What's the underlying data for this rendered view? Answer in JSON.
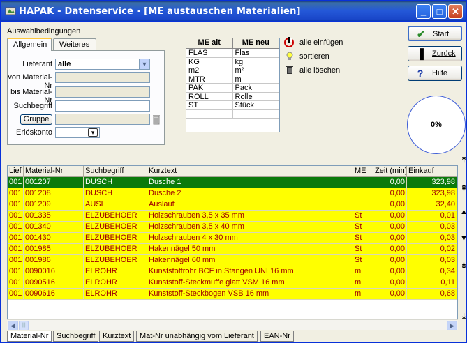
{
  "window": {
    "title": "HAPAK - Datenservice - [ME austauschen Materialien]",
    "minimize": "_",
    "maximize": "□",
    "close": "✕"
  },
  "selection": {
    "group_label": "Auswahlbedingungen",
    "tabs": [
      "Allgemein",
      "Weiteres"
    ],
    "active_tab": "Allgemein",
    "lieferant_label": "Lieferant",
    "lieferant_value": "alle",
    "von_label": "von Material-Nr",
    "bis_label": "bis Material-Nr",
    "such_label": "Suchbegriff",
    "gruppe_button": "Gruppe",
    "erloes_label": "Erlöskonto"
  },
  "me_table": {
    "headers": [
      "ME alt",
      "ME neu"
    ],
    "rows": [
      [
        "FLAS",
        "Flas"
      ],
      [
        "KG",
        "kg"
      ],
      [
        "m2",
        "m²"
      ],
      [
        "MTR",
        "m"
      ],
      [
        "PAK",
        "Pack"
      ],
      [
        "ROLL",
        "Rolle"
      ],
      [
        "ST",
        "Stück"
      ],
      [
        "",
        ""
      ]
    ]
  },
  "actions": {
    "insert_all": "alle einfügen",
    "sort": "sortieren",
    "delete_all": "alle löschen"
  },
  "buttons": {
    "start": "Start",
    "back": "Zurück",
    "help": "Hilfe"
  },
  "progress": {
    "percent": 0,
    "label": "0%"
  },
  "grid": {
    "headers": [
      "Lief",
      "Material-Nr",
      "Suchbegriff",
      "Kurztext",
      "ME",
      "Zeit (min)",
      "Einkauf"
    ],
    "rows": [
      {
        "lief": "001",
        "nr": "001207",
        "such": "DUSCH",
        "kurz": "Dusche 1",
        "me": "",
        "zeit": "0,00",
        "ek": "323,98",
        "style": "green"
      },
      {
        "lief": "001",
        "nr": "001208",
        "such": "DUSCH",
        "kurz": "Dusche 2",
        "me": "",
        "zeit": "0,00",
        "ek": "323,98",
        "style": "yellow"
      },
      {
        "lief": "001",
        "nr": "001209",
        "such": "AUSL",
        "kurz": "Auslauf",
        "me": "",
        "zeit": "0,00",
        "ek": "32,40",
        "style": "yellow"
      },
      {
        "lief": "001",
        "nr": "001335",
        "such": "ELZUBEHOER",
        "kurz": "Holzschrauben 3,5 x 35 mm",
        "me": "St",
        "zeit": "0,00",
        "ek": "0,01",
        "style": "yellow"
      },
      {
        "lief": "001",
        "nr": "001340",
        "such": "ELZUBEHOER",
        "kurz": "Holzschrauben 3,5 x 40 mm",
        "me": "St",
        "zeit": "0,00",
        "ek": "0,03",
        "style": "yellow"
      },
      {
        "lief": "001",
        "nr": "001430",
        "such": "ELZUBEHOER",
        "kurz": "Holzschrauben 4 x 30 mm",
        "me": "St",
        "zeit": "0,00",
        "ek": "0,03",
        "style": "yellow"
      },
      {
        "lief": "001",
        "nr": "001985",
        "such": "ELZUBEHOER",
        "kurz": "Hakennägel 50 mm",
        "me": "St",
        "zeit": "0,00",
        "ek": "0,02",
        "style": "yellow"
      },
      {
        "lief": "001",
        "nr": "001986",
        "such": "ELZUBEHOER",
        "kurz": "Hakennägel 60 mm",
        "me": "St",
        "zeit": "0,00",
        "ek": "0,03",
        "style": "yellow"
      },
      {
        "lief": "001",
        "nr": "0090016",
        "such": "ELROHR",
        "kurz": "Kunststoffrohr BCF in Stangen UNI 16 mm",
        "me": "m",
        "zeit": "0,00",
        "ek": "0,34",
        "style": "yellow"
      },
      {
        "lief": "001",
        "nr": "0090516",
        "such": "ELROHR",
        "kurz": "Kunststoff-Steckmuffe glatt VSM 16 mm",
        "me": "m",
        "zeit": "0,00",
        "ek": "0,11",
        "style": "yellow"
      },
      {
        "lief": "001",
        "nr": "0090616",
        "such": "ELROHR",
        "kurz": "Kunststoff-Steckbogen VSB 16 mm",
        "me": "m",
        "zeit": "0,00",
        "ek": "0,68",
        "style": "yellow"
      }
    ]
  },
  "bottom_tabs": [
    "Material-Nr",
    "Suchbegriff",
    "Kurztext",
    "Mat-Nr unabhängig vom Lieferant",
    "EAN-Nr"
  ],
  "active_bottom_tab": "Material-Nr"
}
